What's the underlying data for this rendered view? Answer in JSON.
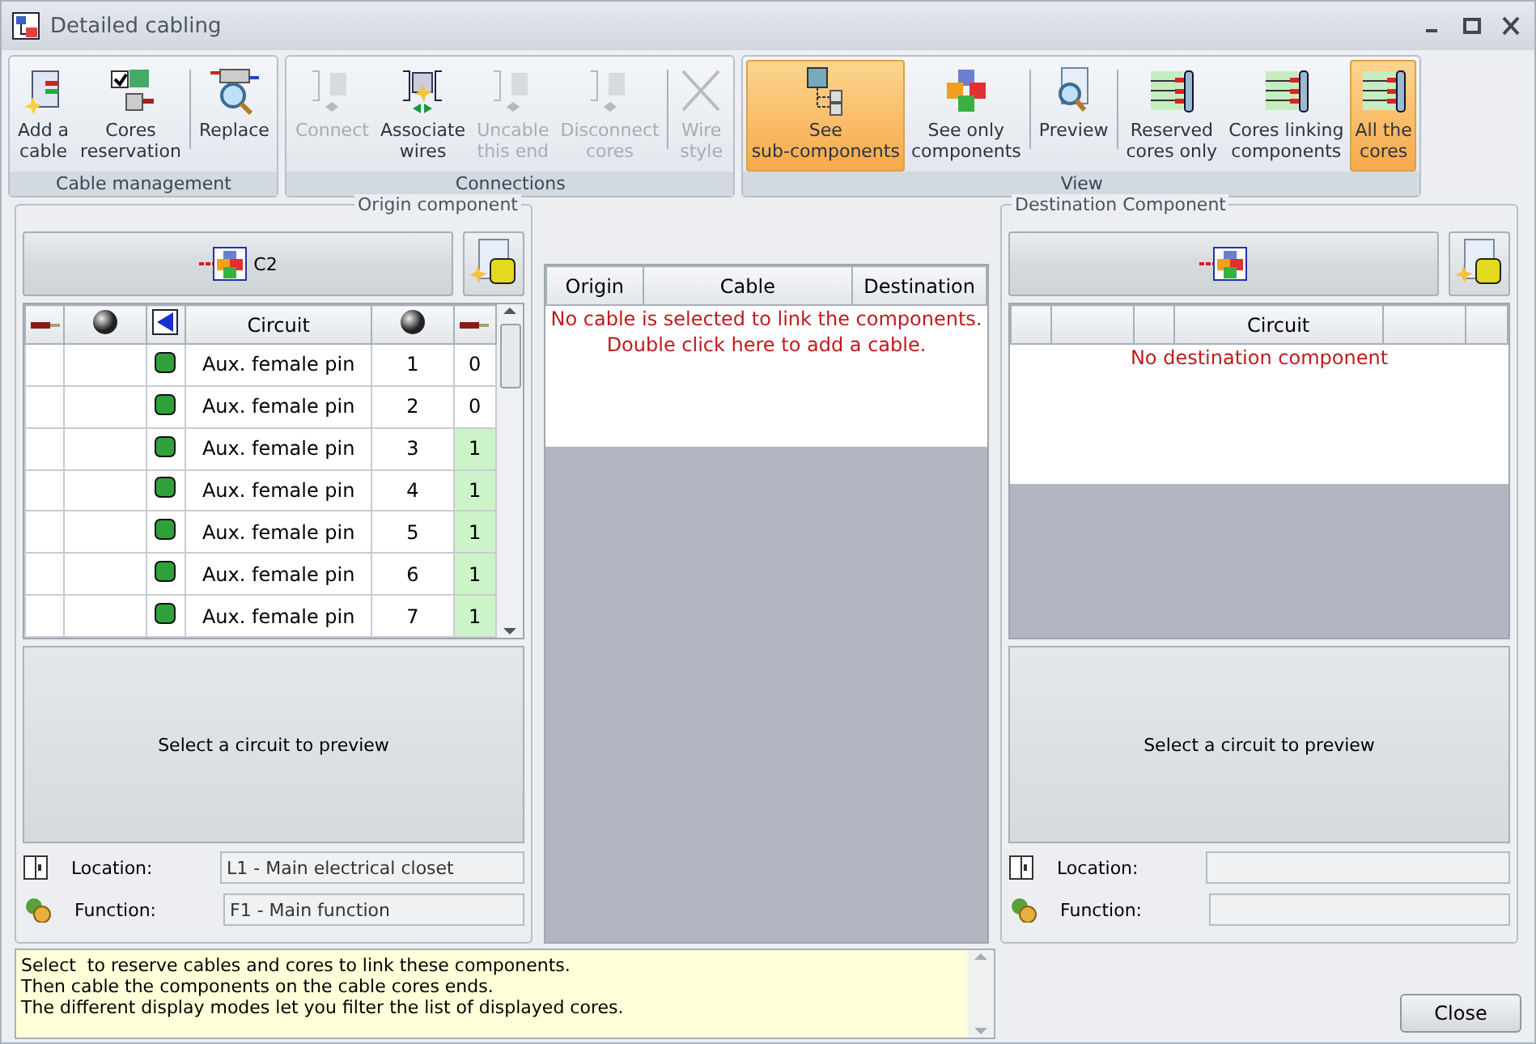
{
  "window": {
    "title": "Detailed cabling"
  },
  "ribbon": [
    {
      "title": "Cable management",
      "buttons": [
        {
          "label": "Add a\ncable",
          "kind": "add",
          "disabled": false,
          "selected": false,
          "sep_after": false
        },
        {
          "label": "Cores\nreservation",
          "kind": "reserve",
          "disabled": false,
          "selected": false,
          "sep_after": true
        },
        {
          "label": "Replace",
          "kind": "replace",
          "disabled": false,
          "selected": false,
          "sep_after": false
        }
      ]
    },
    {
      "title": "Connections",
      "buttons": [
        {
          "label": "Connect",
          "kind": "connect",
          "disabled": true,
          "selected": false,
          "sep_after": false
        },
        {
          "label": "Associate\nwires",
          "kind": "associate",
          "disabled": false,
          "selected": false,
          "sep_after": false
        },
        {
          "label": "Uncable\nthis end",
          "kind": "connect",
          "disabled": true,
          "selected": false,
          "sep_after": false
        },
        {
          "label": "Disconnect\ncores",
          "kind": "connect",
          "disabled": true,
          "selected": false,
          "sep_after": true
        },
        {
          "label": "Wire\nstyle",
          "kind": "wire",
          "disabled": true,
          "selected": false,
          "sep_after": false
        }
      ]
    },
    {
      "title": "View",
      "buttons": [
        {
          "label": "See\nsub-components",
          "kind": "sub",
          "disabled": false,
          "selected": true,
          "sep_after": false
        },
        {
          "label": "See only\ncomponents",
          "kind": "cubes",
          "disabled": false,
          "selected": false,
          "sep_after": true
        },
        {
          "label": "Preview",
          "kind": "preview",
          "disabled": false,
          "selected": false,
          "sep_after": true
        },
        {
          "label": "Reserved\ncores only",
          "kind": "cores",
          "disabled": false,
          "selected": false,
          "sep_after": false
        },
        {
          "label": "Cores linking\ncomponents",
          "kind": "cores",
          "disabled": false,
          "selected": false,
          "sep_after": false
        },
        {
          "label": "All the\ncores",
          "kind": "cores",
          "disabled": false,
          "selected": true,
          "sep_after": false
        }
      ]
    }
  ],
  "origin": {
    "legend": "Origin component",
    "component": "C2",
    "columns": [
      {
        "kind": "wire"
      },
      {
        "kind": "ball"
      },
      {
        "kind": "arrow"
      },
      {
        "kind": "text",
        "label": "Circuit"
      },
      {
        "kind": "ball"
      },
      {
        "kind": "wire"
      }
    ],
    "rows": [
      {
        "circuit": "Aux. female pin",
        "pin": "1",
        "count": "0",
        "reserved": false
      },
      {
        "circuit": "Aux. female pin",
        "pin": "2",
        "count": "0",
        "reserved": false
      },
      {
        "circuit": "Aux. female pin",
        "pin": "3",
        "count": "1",
        "reserved": true
      },
      {
        "circuit": "Aux. female pin",
        "pin": "4",
        "count": "1",
        "reserved": true
      },
      {
        "circuit": "Aux. female pin",
        "pin": "5",
        "count": "1",
        "reserved": true
      },
      {
        "circuit": "Aux. female pin",
        "pin": "6",
        "count": "1",
        "reserved": true
      },
      {
        "circuit": "Aux. female pin",
        "pin": "7",
        "count": "1",
        "reserved": true
      }
    ],
    "preview": "Select a circuit to preview",
    "fields": [
      {
        "label": "Location:",
        "value": "L1 - Main electrical closet"
      },
      {
        "label": "Function:",
        "value": "F1 - Main function"
      }
    ]
  },
  "cables": {
    "columns": [
      "Origin",
      "Cable",
      "Destination"
    ],
    "message": [
      "No cable is selected to link the components.",
      "Double click here to add a cable."
    ]
  },
  "destination": {
    "legend": "Destination Component",
    "columns": [
      "",
      "",
      "",
      "Circuit",
      "",
      ""
    ],
    "message": "No destination component",
    "preview": "Select a circuit to preview",
    "fields": [
      {
        "label": "Location:"
      },
      {
        "label": "Function:"
      }
    ]
  },
  "hint": [
    "Select  to reserve cables and cores to link these components.",
    "Then cable the components on the cable cores ends.",
    "The different display modes let you filter the list of displayed cores."
  ],
  "close_button": "Close"
}
